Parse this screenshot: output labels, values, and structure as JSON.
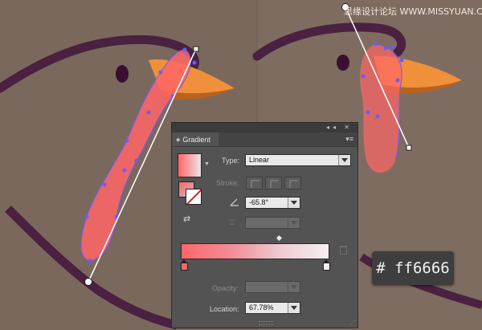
{
  "watermark": "思缘设计论坛 WWW.MISSYUAN.COM",
  "hex_badge": "# ff6666",
  "colors": {
    "background": "#7d6a5f",
    "gradient_start": "#ff6666",
    "panel_bg": "#535353",
    "outline_purple": "#4a2140",
    "beak_orange": "#f0903a",
    "anchor_blue": "#6a5cff"
  },
  "panel": {
    "tab_title": "Gradient",
    "title_buttons": "◂◂ ✕",
    "menu_icon": "▾≡",
    "type_label": "Type:",
    "type_value": "Linear",
    "stroke_label": "Stroke:",
    "angle_value": "-65.8°",
    "aspect_value": "",
    "opacity_label": "Opacity:",
    "opacity_value": "",
    "location_label": "Location:",
    "location_value": "67.78%",
    "stops": [
      {
        "color": "#ff6666",
        "location_percent": 0
      },
      {
        "color": "#f4f0f2",
        "location_percent": 100
      }
    ]
  }
}
